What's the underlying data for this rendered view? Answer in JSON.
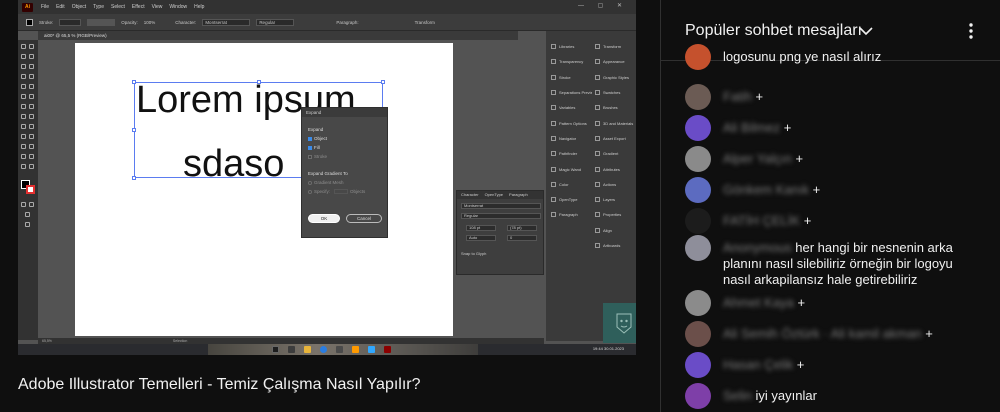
{
  "app": {
    "menu_items": [
      "File",
      "Edit",
      "Object",
      "Type",
      "Select",
      "Effect",
      "View",
      "Window",
      "Help"
    ],
    "logo": "Ai",
    "controlbar": {
      "stroke_label": "Stroke:",
      "opacity_label": "Opacity:",
      "opacity_value": "100%",
      "character_label": "Character:",
      "font": "Montserrat",
      "style": "Regular",
      "paragraph_label": "Paragraph:",
      "transform_label": "Transform"
    },
    "doc_tab": "ai00* @ 65,5 % (RGB/Preview)",
    "canvas_text_1": "Lorem ipsum",
    "canvas_text_2": "sdaso",
    "expand_dialog": {
      "title": "Expand",
      "section_label": "Expand",
      "object_label": "Object",
      "fill_label": "Fill",
      "stroke_label": "Stroke",
      "gradient_label": "Expand Gradient To",
      "gradient_mesh_label": "Gradient Mesh",
      "specify_label": "Specify:",
      "objects_label": "Objects",
      "ok_label": "OK",
      "cancel_label": "Cancel"
    },
    "character_panel": {
      "tabs": [
        "Character",
        "OpenType",
        "Paragraph"
      ],
      "font": "Montserrat",
      "style": "Regular",
      "size": "108 pt",
      "leading": "(78 pt)",
      "tracking": "Auto",
      "kerning": "0",
      "snap_label": "Snap to Glyph"
    },
    "panels_left": [
      "Libraries",
      "Transparency",
      "Stroke",
      "Separations Previe...",
      "Variables",
      "Pattern Options",
      "Navigator",
      "Pathfinder",
      "Magic Wand",
      "Color",
      "OpenType",
      "Paragraph"
    ],
    "panels_right": [
      "Transform",
      "Appearance",
      "Graphic Styles",
      "Swatches",
      "Brushes",
      "3D and Materials",
      "Asset Export",
      "Gradient",
      "Attributes",
      "Actions",
      "Layers",
      "Properties",
      "Align",
      "Artboards"
    ],
    "status": {
      "zoom": "65,5%",
      "tool": "Selection"
    },
    "taskbar_time": "19:44",
    "taskbar_date": "30.01.2023"
  },
  "video": {
    "title": "Adobe Illustrator Temelleri - Temiz Çalışma Nasıl Yapılır?"
  },
  "chat": {
    "title": "Popüler sohbet mesajları",
    "messages": [
      {
        "avatar_color": "#c5512d",
        "name": "",
        "text": "logosunu png ye nasıl alırız",
        "cont": ""
      },
      {
        "avatar_color": "#6b5b54",
        "name": "Fatih",
        "text": "+",
        "cont": ""
      },
      {
        "avatar_color": "#6a4cc7",
        "name": "Ali Bilmez",
        "text": "+",
        "cont": ""
      },
      {
        "avatar_color": "#8a8a8a",
        "name": "Alper Yalçın",
        "text": "+",
        "cont": ""
      },
      {
        "avatar_color": "#5c6bc0",
        "name": "Gönkem Kanık",
        "text": "+",
        "cont": ""
      },
      {
        "avatar_color": "#1c1c1c",
        "name": "FATİH ÇELİK",
        "text": "+",
        "cont": ""
      },
      {
        "avatar_color": "#8e8e9a",
        "name": "Anonymous",
        "text": "her hangi bir nesnenin arka",
        "cont": [
          "planını nasıl silebiliriz örneğin bir logoyu",
          "nasıl arkapilansız hale getirebiliriz"
        ]
      },
      {
        "avatar_color": "#8b8b8b",
        "name": "Ahmet Kaya",
        "text": "+",
        "cont": ""
      },
      {
        "avatar_color": "#6b4f4a",
        "name": "Ali Semih Öztürk · Ali kamil akman",
        "text": "+",
        "cont": ""
      },
      {
        "avatar_color": "#6a4cc7",
        "name": "Hasan Çelik",
        "text": "+",
        "cont": ""
      },
      {
        "avatar_color": "#7e3fa8",
        "name": "Selin",
        "text": "iyi yayınlar",
        "cont": ""
      }
    ]
  }
}
